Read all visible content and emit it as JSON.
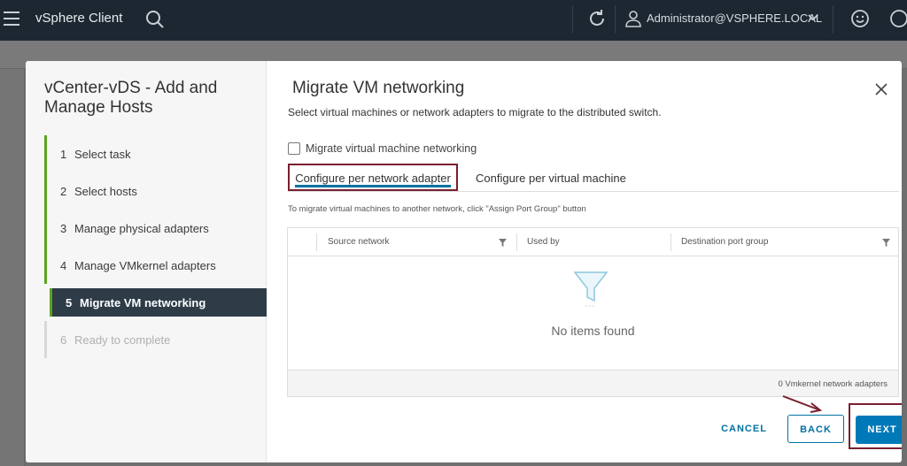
{
  "header": {
    "app_title": "vSphere Client",
    "user": "Administrator@VSPHERE.LOCAL"
  },
  "wizard": {
    "title": "vCenter-vDS - Add and Manage Hosts",
    "steps": [
      {
        "num": "1",
        "label": "Select task",
        "state": "done"
      },
      {
        "num": "2",
        "label": "Select hosts",
        "state": "done"
      },
      {
        "num": "3",
        "label": "Manage physical adapters",
        "state": "done"
      },
      {
        "num": "4",
        "label": "Manage VMkernel adapters",
        "state": "done"
      },
      {
        "num": "5",
        "label": "Migrate VM networking",
        "state": "active"
      },
      {
        "num": "6",
        "label": "Ready to complete",
        "state": "disabled"
      }
    ]
  },
  "dialog": {
    "title": "Migrate VM networking",
    "description": "Select virtual machines or network adapters to migrate to the distributed switch.",
    "checkbox_label": "Migrate virtual machine networking",
    "checkbox_checked": false,
    "tabs": [
      {
        "label": "Configure per network adapter",
        "selected": true
      },
      {
        "label": "Configure per virtual machine",
        "selected": false
      }
    ],
    "hint": "To migrate virtual machines to another network, click \"Assign Port Group\" button",
    "table": {
      "columns": [
        "Source network",
        "Used by",
        "Destination port group"
      ],
      "empty_text": "No items found",
      "footer": "0 Vmkernel network adapters"
    },
    "buttons": {
      "cancel": "CANCEL",
      "back": "BACK",
      "next": "NEXT"
    }
  },
  "colors": {
    "header_bg": "#1d2731",
    "accent_blue": "#0079b8",
    "step_green": "#5aa220",
    "highlight_box": "#7a1f2f"
  }
}
